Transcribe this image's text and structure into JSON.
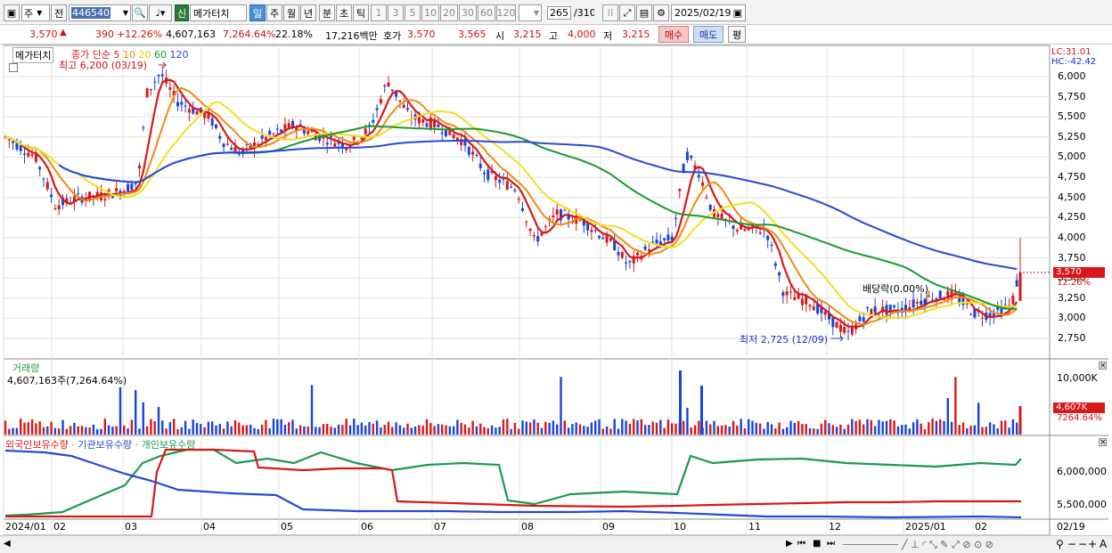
{
  "toolbar": {
    "market": "주",
    "prev": "전",
    "code": "446540",
    "sin": "신",
    "name": "메가터치",
    "periods": [
      "일",
      "주",
      "월",
      "년",
      "분",
      "초",
      "틱"
    ],
    "ticks": [
      "1",
      "3",
      "5",
      "10",
      "20",
      "30",
      "60",
      "120"
    ],
    "count": "265",
    "count_total": "/310",
    "date": "2025/02/19"
  },
  "quote": {
    "price": "3,570",
    "change": "390",
    "rate": "+12.26%",
    "volume": "4,607,163",
    "vol_rate": "7,264.64%",
    "turnover": "22.18%",
    "amount": "17,216백만",
    "ask_label": "호가",
    "ask": "3,570",
    "bid": "3,565",
    "open_label": "시",
    "open": "3,215",
    "high_label": "고",
    "high": "4,000",
    "low_label": "저",
    "low": "3,215",
    "buy": "매수",
    "sell": "매도",
    "eval": "평"
  },
  "price_panel": {
    "name_tag": "메가터치",
    "legend_prefix": "종가 단순",
    "ma_periods": [
      "5",
      "10",
      "20",
      "60",
      "120"
    ],
    "ma_colors": [
      "#d81818",
      "#f08a10",
      "#f0e020",
      "#1a9a30",
      "#2848d8"
    ],
    "high_note": "최고 6,200 (03/19)",
    "low_note": "최저 2,725 (12/09)",
    "dividend_note": "배당락(0.00%)",
    "lc": "LC:31.01",
    "hc": "HC:-42.42",
    "y_ticks": [
      "6,000",
      "5,750",
      "5,500",
      "5,250",
      "5,000",
      "4,750",
      "4,500",
      "4,250",
      "4,000",
      "3,750",
      "3,500",
      "3,250",
      "3,000",
      "2,750"
    ],
    "cur_price": "3,570",
    "cur_rate": "12.26%"
  },
  "volume_panel": {
    "title": "거래량",
    "value": "4,607,163주(7,264.64%)",
    "y_tick": "10,000K",
    "cur": "4,607K",
    "cur_rate": "7264.64%"
  },
  "holding_panel": {
    "series": [
      "외국인보유수량",
      "기관보유수량",
      "개인보유수량"
    ],
    "colors": [
      "#d81818",
      "#2848d8",
      "#1a9a50"
    ],
    "y_ticks": [
      "6,000,000",
      "5,500,000"
    ]
  },
  "x_axis": {
    "labels": [
      "2024/01",
      "02",
      "03",
      "04",
      "05",
      "06",
      "07",
      "08",
      "09",
      "10",
      "11",
      "12",
      "2025/01",
      "02"
    ],
    "right_label": "02/19"
  }
}
